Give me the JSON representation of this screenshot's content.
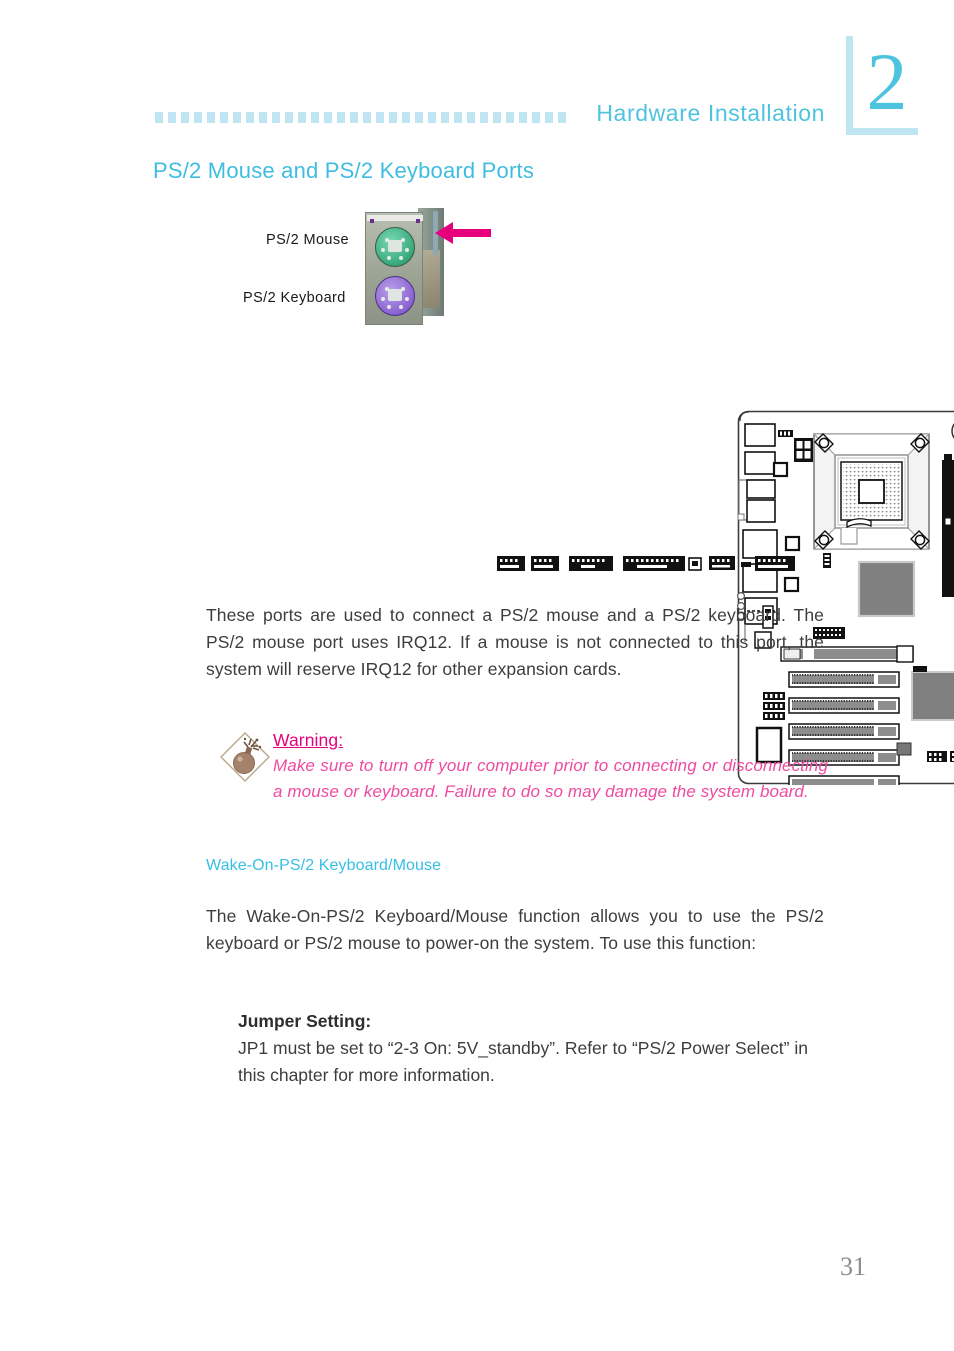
{
  "header": {
    "chapter_number": "2",
    "title": "Hardware Installation"
  },
  "section": {
    "heading": "PS/2 Mouse and PS/2 Keyboard Ports",
    "subheading": "Wake-On-PS/2 Keyboard/Mouse"
  },
  "figure": {
    "label_mouse": "PS/2  Mouse",
    "label_keyboard": "PS/2  Keyboard",
    "arrow_name": "pointer-arrow",
    "board_caption": ""
  },
  "body": {
    "paragraph_1": "These ports are used to connect a PS/2 mouse and a PS/2 keyboard. The PS/2 mouse port uses IRQ12. If a mouse is not connected to this port, the system will reserve IRQ12 for other expansion cards.",
    "paragraph_2": "The Wake-On-PS/2 Keyboard/Mouse function allows you to use the PS/2 keyboard or PS/2 mouse to power-on the system. To use this function:"
  },
  "warning": {
    "icon": "bomb-icon",
    "title": "Warning:",
    "text": "Make sure to turn off your computer prior to connecting or disconnecting a mouse or keyboard. Failure to do so may damage the system board."
  },
  "jumper": {
    "title": "Jumper Setting:",
    "text": "JP1 must be set to “2-3 On: 5V_standby”. Refer to “PS/2 Power Select” in this chapter for more information."
  },
  "footer": {
    "page_number": "31"
  },
  "colors": {
    "accent_cyan": "#4ec3e0",
    "accent_light_blue": "#bfe4f2",
    "accent_magenta": "#e6007e",
    "warning_pink": "#ef4ba0",
    "body_gray": "#3d3d3d",
    "page_number_gray": "#8c8c8c",
    "jack_mouse_green": "#38a87c",
    "jack_keyboard_purple": "#8a63d2"
  }
}
